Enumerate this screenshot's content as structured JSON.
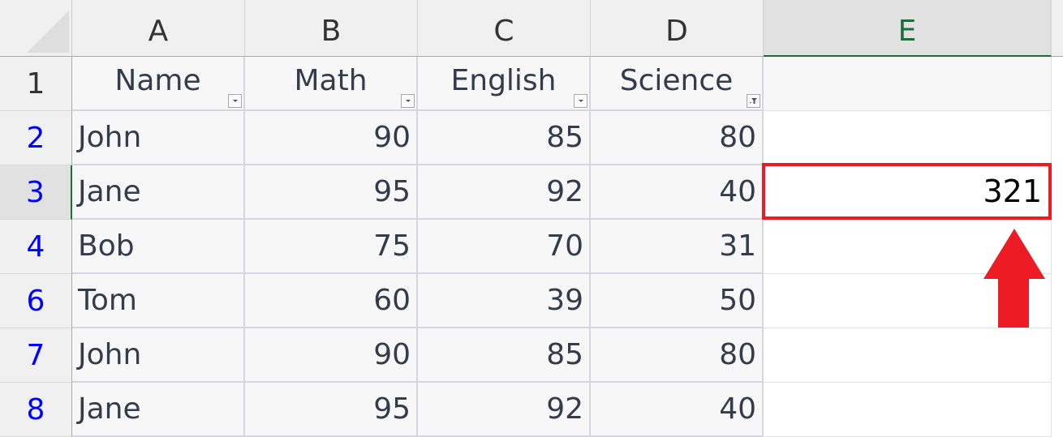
{
  "sheet": {
    "columns": [
      "A",
      "B",
      "C",
      "D",
      "E"
    ],
    "selected_column": "E",
    "selected_row": "3",
    "header_row_number": "1",
    "headers": [
      "Name",
      "Math",
      "English",
      "Science"
    ],
    "filter_icons": [
      "dropdown",
      "dropdown",
      "dropdown",
      "filter-applied"
    ],
    "rows": [
      {
        "row": "2",
        "name": "John",
        "math": "90",
        "english": "85",
        "science": "80",
        "e": ""
      },
      {
        "row": "3",
        "name": "Jane",
        "math": "95",
        "english": "92",
        "science": "40",
        "e": "321"
      },
      {
        "row": "4",
        "name": "Bob",
        "math": "75",
        "english": "70",
        "science": "31",
        "e": ""
      },
      {
        "row": "6",
        "name": "Tom",
        "math": "60",
        "english": "39",
        "science": "50",
        "e": ""
      },
      {
        "row": "7",
        "name": "John",
        "math": "90",
        "english": "85",
        "science": "80",
        "e": ""
      },
      {
        "row": "8",
        "name": "Jane",
        "math": "95",
        "english": "92",
        "science": "40",
        "e": ""
      }
    ]
  },
  "highlight": {
    "cell": "E3",
    "value": "321",
    "box_color": "#ed1c24",
    "arrow_color": "#ed1c24"
  },
  "colors": {
    "selected_header_accent": "#1e6b3c",
    "filtered_row_number": "#0000ff"
  }
}
